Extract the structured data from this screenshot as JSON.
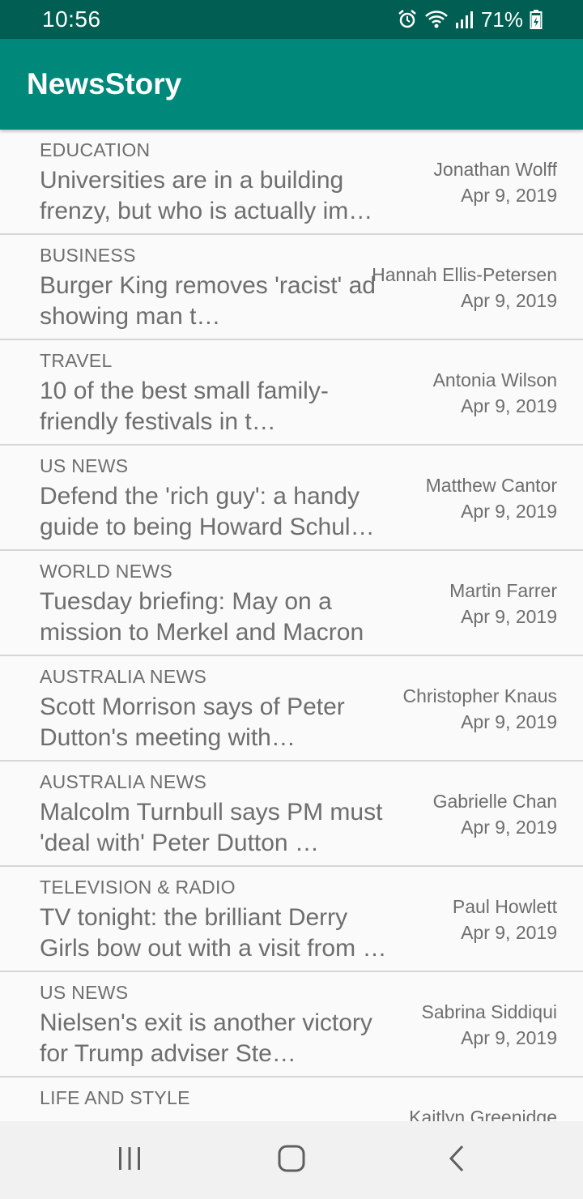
{
  "status_bar": {
    "time": "10:56",
    "battery_percent": "71%",
    "icons": [
      "alarm-icon",
      "wifi-icon",
      "signal-icon",
      "battery-icon"
    ]
  },
  "app_bar": {
    "title": "NewsStory",
    "color": "#00897b"
  },
  "articles": [
    {
      "section": "EDUCATION",
      "title": "Universities are in a building frenzy, but who is actually im…",
      "author": "Jonathan Wolff",
      "date": "Apr 9, 2019"
    },
    {
      "section": "BUSINESS",
      "title": "Burger King removes 'racist' ad showing man t…",
      "author": "Hannah Ellis-Petersen",
      "date": "Apr 9, 2019"
    },
    {
      "section": "TRAVEL",
      "title": "10 of the best small family-friendly festivals in t…",
      "author": "Antonia Wilson",
      "date": "Apr 9, 2019"
    },
    {
      "section": "US NEWS",
      "title": "Defend the 'rich guy': a handy guide to being Howard Schul…",
      "author": "Matthew Cantor",
      "date": "Apr 9, 2019"
    },
    {
      "section": "WORLD NEWS",
      "title": "Tuesday briefing: May on a mission to Merkel and Macron",
      "author": "Martin Farrer",
      "date": "Apr 9, 2019"
    },
    {
      "section": "AUSTRALIA NEWS",
      "title": "Scott Morrison says of Peter Dutton's meeting with…",
      "author": "Christopher Knaus",
      "date": "Apr 9, 2019"
    },
    {
      "section": "AUSTRALIA NEWS",
      "title": "Malcolm Turnbull says PM must 'deal with' Peter Dutton …",
      "author": "Gabrielle Chan",
      "date": "Apr 9, 2019"
    },
    {
      "section": "TELEVISION & RADIO",
      "title": "TV tonight: the brilliant Derry Girls bow out with a visit from …",
      "author": "Paul Howlett",
      "date": "Apr 9, 2019"
    },
    {
      "section": "US NEWS",
      "title": "Nielsen's exit is another victory for Trump adviser Ste…",
      "author": "Sabrina Siddiqui",
      "date": "Apr 9, 2019"
    },
    {
      "section": "LIFE AND STYLE",
      "title": "",
      "author": "Kaitlyn Greenidge",
      "date": ""
    }
  ],
  "nav_bar": {
    "buttons": [
      "recent-apps-icon",
      "home-icon",
      "back-icon"
    ]
  }
}
